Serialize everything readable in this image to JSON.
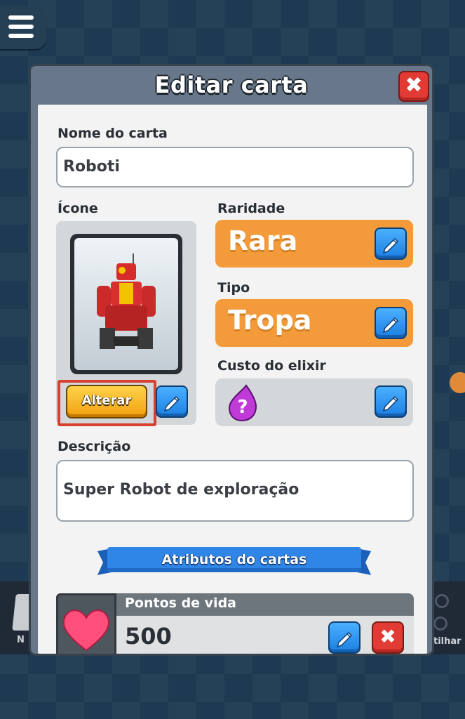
{
  "dialog": {
    "title": "Editar carta",
    "close_label": "✖"
  },
  "name_field": {
    "label": "Nome do carta",
    "value": "Roboti"
  },
  "icon_section": {
    "label": "Ícone",
    "change_button": "Alterar"
  },
  "rarity": {
    "label": "Raridade",
    "value": "Rara"
  },
  "type": {
    "label": "Tipo",
    "value": "Tropa"
  },
  "elixir_cost": {
    "label": "Custo do elixir",
    "value": "?"
  },
  "description": {
    "label": "Descrição",
    "value": "Super Robot de exploração"
  },
  "attributes": {
    "banner": "Atributos do cartas",
    "items": [
      {
        "name": "Pontos de vida",
        "value": "500",
        "icon": "heart-icon"
      }
    ]
  },
  "bottom_bar": {
    "left_label": "N",
    "right_label": "tilhar"
  },
  "colors": {
    "accent_orange": "#f39a3a",
    "button_blue": "#1c7fe2",
    "close_red": "#e23a35",
    "selection_outline": "#d8402f"
  },
  "icons": [
    "menu-icon",
    "close-icon",
    "pencil-icon",
    "elixir-drop-icon",
    "heart-icon",
    "robot-card-image"
  ]
}
